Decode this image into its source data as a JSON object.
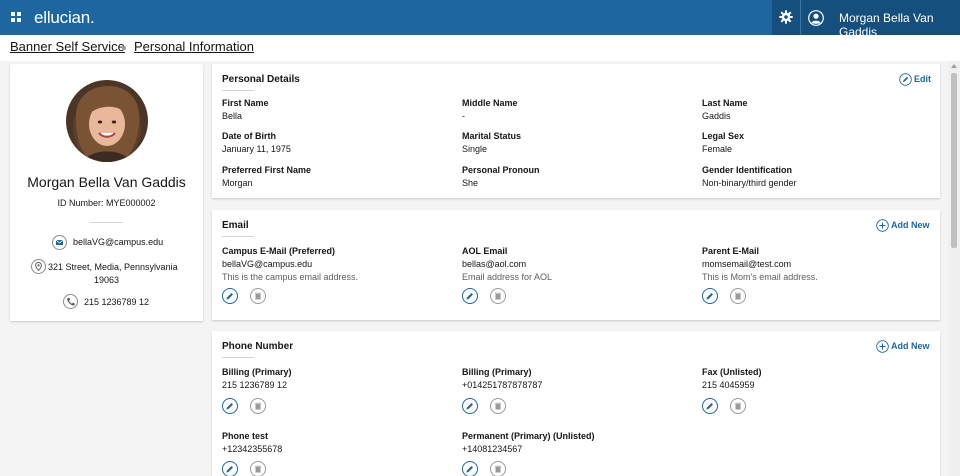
{
  "header": {
    "logo": "ellucian.",
    "username": "Morgan Bella Van Gaddis"
  },
  "breadcrumbs": [
    "Banner Self Service",
    "Personal Information"
  ],
  "profile": {
    "name": "Morgan Bella Van Gaddis",
    "id_label": "ID Number: MYE000002",
    "email": "bellaVG@campus.edu",
    "address_line1": "321 Street, Media, Pennsylvania",
    "address_line2": "19063",
    "phone": "215 1236789 12"
  },
  "personal_details": {
    "title": "Personal Details",
    "action_label": "Edit",
    "fields": [
      {
        "label": "First Name",
        "value": "Bella"
      },
      {
        "label": "Middle Name",
        "value": "-"
      },
      {
        "label": "Last Name",
        "value": "Gaddis"
      },
      {
        "label": "Date of Birth",
        "value": "January 11, 1975"
      },
      {
        "label": "Marital Status",
        "value": "Single"
      },
      {
        "label": "Legal Sex",
        "value": "Female"
      },
      {
        "label": "Preferred First Name",
        "value": "Morgan"
      },
      {
        "label": "Personal Pronoun",
        "value": "She"
      },
      {
        "label": "Gender Identification",
        "value": "Non-binary/third gender"
      }
    ]
  },
  "email_section": {
    "title": "Email",
    "action_label": "Add New",
    "items": [
      {
        "label": "Campus E-Mail (Preferred)",
        "value": "bellaVG@campus.edu",
        "desc": "This is the campus email address."
      },
      {
        "label": "AOL Email",
        "value": "bellas@aol.com",
        "desc": "Email address for AOL"
      },
      {
        "label": "Parent E-Mail",
        "value": "momsemail@test.com",
        "desc": "This is Mom's email address."
      }
    ]
  },
  "phone_section": {
    "title": "Phone Number",
    "action_label": "Add New",
    "items": [
      {
        "label": "Billing (Primary)",
        "value": "215 1236789 12"
      },
      {
        "label": "Billing (Primary)",
        "value": "+014251787878787"
      },
      {
        "label": "Fax (Unlisted)",
        "value": "215 4045959"
      },
      {
        "label": "Phone test",
        "value": "+12342355678"
      },
      {
        "label": "Permanent (Primary) (Unlisted)",
        "value": "+14081234567"
      }
    ]
  },
  "colors": {
    "brand": "#1d66a0",
    "brand_dark": "#154f7d",
    "background": "#f4f4f4"
  }
}
